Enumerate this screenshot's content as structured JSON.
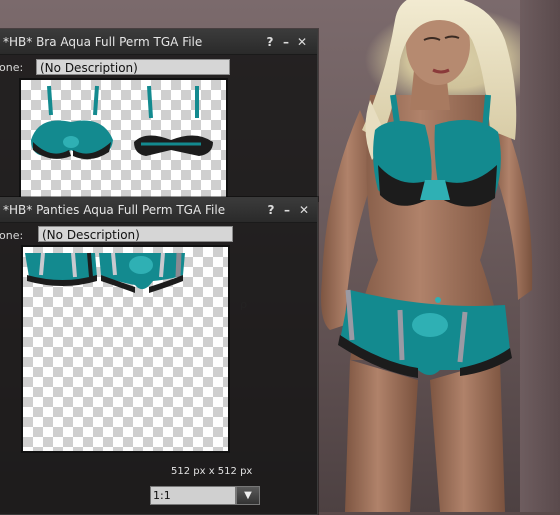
{
  "bra_window": {
    "title": "*HB* Bra Aqua Full Perm TGA File",
    "description_label": "one:",
    "description_value": "(No Description)",
    "help_label": "?",
    "minimize_label": "–",
    "close_label": "✕"
  },
  "panties_window": {
    "title": "*HB* Panties Aqua Full Perm TGA File",
    "description_label": "one:",
    "description_value": "(No Description)",
    "help_label": "?",
    "minimize_label": "–",
    "close_label": "✕",
    "dimensions": "512 px x 512 px",
    "zoom_value": "1:1",
    "zoom_arrow": "▼"
  },
  "colors": {
    "aqua": "#138a8f",
    "aqua_light": "#2fb0b4",
    "lace": "#1c1c1c",
    "skin": "#a6765a"
  },
  "icons": [
    "help-icon",
    "minimize-icon",
    "close-icon",
    "dropdown-arrow-icon"
  ]
}
